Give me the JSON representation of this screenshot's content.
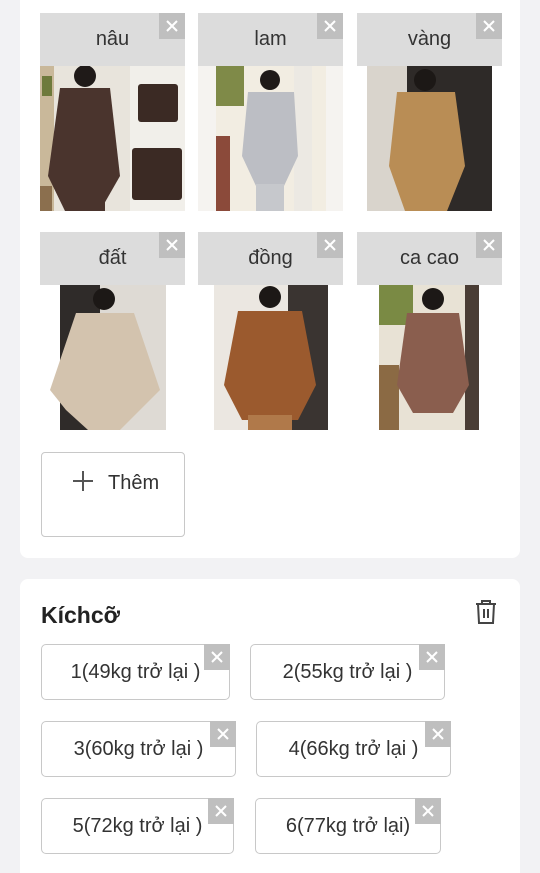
{
  "variants": [
    {
      "label": "nâu"
    },
    {
      "label": "lam"
    },
    {
      "label": "vàng"
    },
    {
      "label": "đất"
    },
    {
      "label": "đồng"
    },
    {
      "label": "ca cao"
    }
  ],
  "add_button": {
    "label": "Thêm"
  },
  "sizes_section": {
    "title": "Kíchcỡ",
    "items": [
      {
        "label": "1(49kg trở lại )"
      },
      {
        "label": "2(55kg trở lại )"
      },
      {
        "label": "3(60kg trở lại )"
      },
      {
        "label": "4(66kg trở lại )"
      },
      {
        "label": "5(72kg trở lại )"
      },
      {
        "label": "6(77kg trở lại)"
      }
    ]
  },
  "icons": {
    "remove": "close-icon",
    "add": "plus-icon",
    "delete": "trash-icon"
  },
  "colors": {
    "variant_label_bg": "#dcdcdc",
    "close_bg": "#bfbfbf",
    "chip_border": "#c8c8c8",
    "page_bg": "#f2f2f4"
  }
}
